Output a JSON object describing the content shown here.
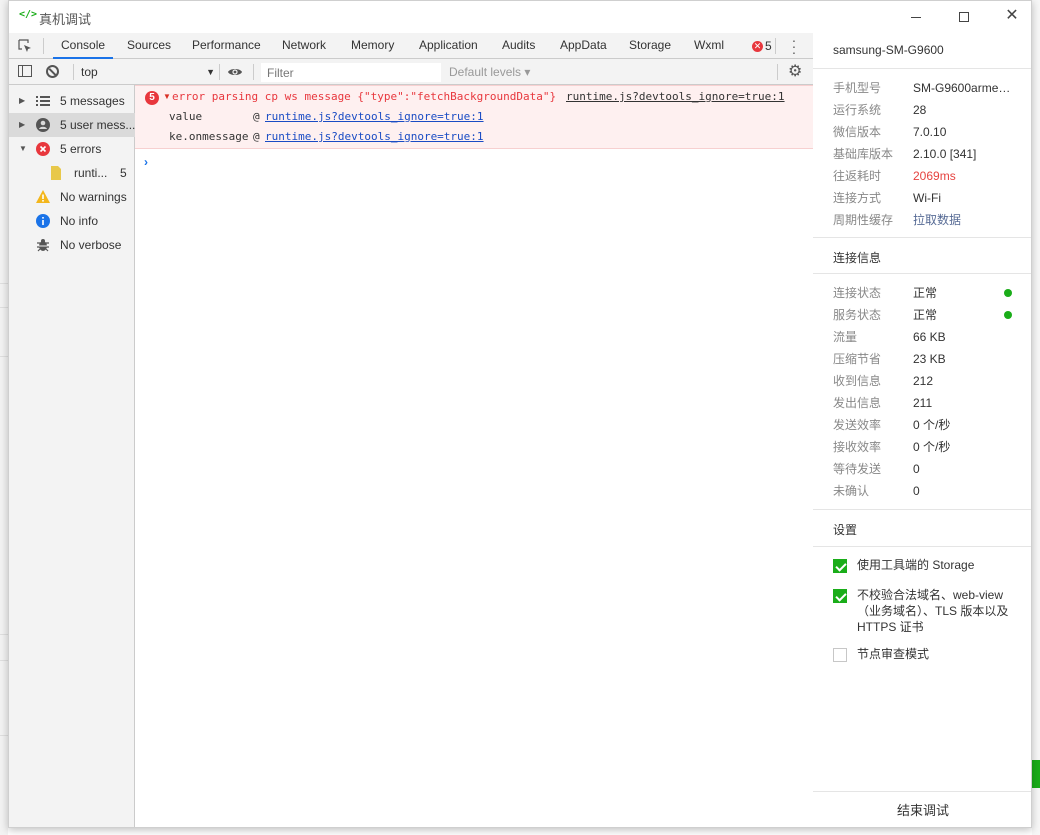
{
  "window": {
    "title": "真机调试"
  },
  "tabs": [
    "Console",
    "Sources",
    "Performance",
    "Network",
    "Memory",
    "Application",
    "Audits",
    "AppData",
    "Storage",
    "Wxml"
  ],
  "error_badge_count": "5",
  "toolbar": {
    "context": "top",
    "filter_placeholder": "Filter",
    "levels": "Default levels ▾"
  },
  "sidebar": [
    {
      "label": "5 messages",
      "icon": "list-icon"
    },
    {
      "label": "5 user mess...",
      "icon": "user-icon"
    },
    {
      "label": "5 errors",
      "icon": "error-icon"
    },
    {
      "label": "runti...",
      "count": "5",
      "icon": "file-icon"
    },
    {
      "label": "No warnings",
      "icon": "warning-icon"
    },
    {
      "label": "No info",
      "icon": "info-icon"
    },
    {
      "label": "No verbose",
      "icon": "bug-icon"
    }
  ],
  "console": {
    "error_count": "5",
    "error_message": "error parsing cp ws message {\"type\":\"fetchBackgroundData\"}",
    "error_source": "runtime.js?devtools_ignore=true:1",
    "stack": [
      {
        "fn": "value",
        "at": "@",
        "link": "runtime.js?devtools_ignore=true:1"
      },
      {
        "fn": "ke.onmessage",
        "at": "@",
        "link": "runtime.js?devtools_ignore=true:1"
      }
    ],
    "prompt": "›"
  },
  "info": {
    "device": "samsung-SM-G9600",
    "device_rows": [
      {
        "k": "手机型号",
        "v": "SM-G9600armea..."
      },
      {
        "k": "运行系统",
        "v": "28"
      },
      {
        "k": "微信版本",
        "v": "7.0.10"
      },
      {
        "k": "基础库版本",
        "v": "2.10.0 [341]"
      },
      {
        "k": "往返耗时",
        "v": "2069ms"
      },
      {
        "k": "连接方式",
        "v": "Wi-Fi"
      },
      {
        "k": "周期性缓存",
        "v": "拉取数据"
      }
    ],
    "conn_title": "连接信息",
    "conn_rows": [
      {
        "k": "连接状态",
        "v": "正常"
      },
      {
        "k": "服务状态",
        "v": "正常"
      },
      {
        "k": "流量",
        "v": "66 KB"
      },
      {
        "k": "压缩节省",
        "v": "23 KB"
      },
      {
        "k": "收到信息",
        "v": "212"
      },
      {
        "k": "发出信息",
        "v": "211"
      },
      {
        "k": "发送效率",
        "v": "0 个/秒"
      },
      {
        "k": "接收效率",
        "v": "0 个/秒"
      },
      {
        "k": "等待发送",
        "v": "0"
      },
      {
        "k": "未确认",
        "v": "0"
      }
    ],
    "settings_title": "设置",
    "settings": [
      {
        "label": "使用工具端的 Storage",
        "checked": true
      },
      {
        "label": "不校验合法域名、web-view（业务域名）、TLS 版本以及 HTTPS 证书",
        "checked": true
      },
      {
        "label": "节点审查模式",
        "checked": false
      }
    ],
    "end_button": "结束调试"
  },
  "colors": {
    "accent": "#1a73e8",
    "error": "#e8373d",
    "ok": "#1aad19",
    "latency": "#e64340"
  }
}
